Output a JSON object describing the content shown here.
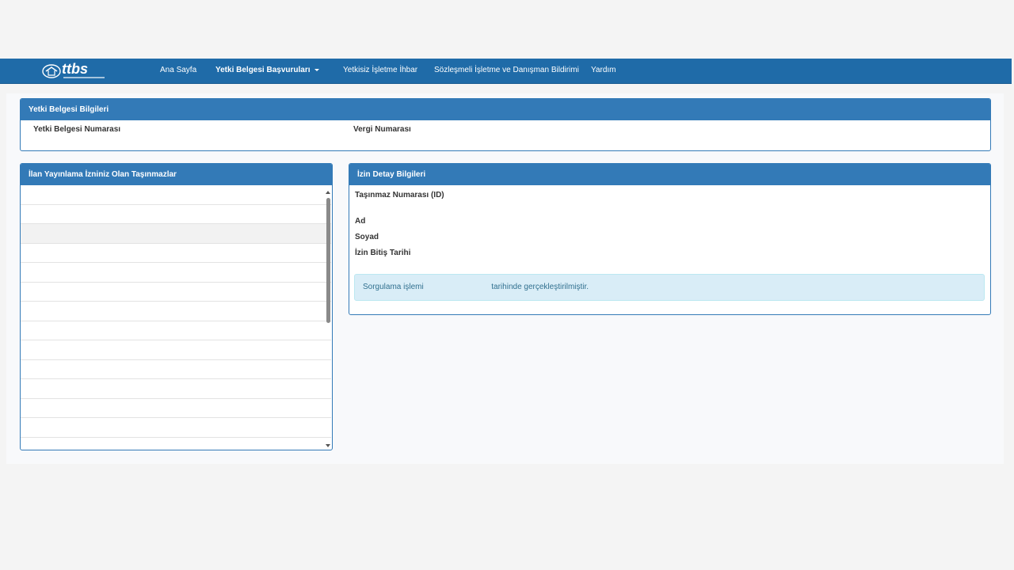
{
  "nav": {
    "logo_text": "ttbs",
    "items": [
      {
        "label": "Ana Sayfa"
      },
      {
        "label": "Yetki Belgesi Başvuruları"
      },
      {
        "label": "Yetkisiz İşletme İhbar"
      },
      {
        "label": "Sözleşmeli İşletme ve Danışman Bildirimi"
      },
      {
        "label": "Yardım"
      }
    ]
  },
  "yetki_panel": {
    "title": "Yetki Belgesi Bilgileri",
    "field_1": "Yetki Belgesi Numarası",
    "field_2": "Vergi Numarası"
  },
  "ilan_panel": {
    "title": "İlan Yayınlama İzniniz Olan Taşınmazlar",
    "row_count": 13,
    "active_row_index": 2
  },
  "izin_panel": {
    "title": "İzin Detay Bilgileri",
    "field_id": "Taşınmaz Numarası (ID)",
    "field_ad": "Ad",
    "field_soyad": "Soyad",
    "field_tarih": "İzin Bitiş Tarihi",
    "alert_prefix": "Sorgulama işlemi",
    "alert_suffix": "tarihinde gerçekleştirilmiştir."
  },
  "colors": {
    "navbar": "#1f6ba8",
    "panel_header": "#337ab7",
    "alert_bg": "#d9edf7"
  }
}
